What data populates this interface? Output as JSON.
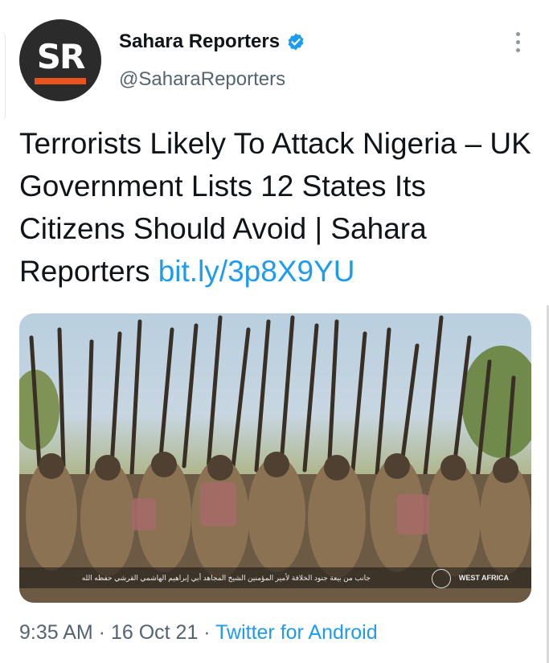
{
  "tweet": {
    "author_name": "Sahara Reporters",
    "handle": "@SaharaReporters",
    "avatar_text": "SR",
    "text": "Terrorists Likely To Attack Nigeria – UK Government Lists 12 States Its Citizens Should Avoid | Sahara Reporters ",
    "link": "bit.ly/3p8X9YU",
    "time": "9:35 AM",
    "separator": " · ",
    "date": "16 Oct 21",
    "source": "Twitter for Android"
  },
  "media": {
    "caption_arabic": "جانب من بيعة جنود الخلافة لأمير المؤمنين الشيخ المجاهد أبي إبراهيم الهاشمي القرشي حفظه الله",
    "region_label": "WEST AFRICA"
  },
  "icons": {
    "verified": "verified-badge-icon",
    "more": "more-options-icon"
  },
  "colors": {
    "link": "#1d9bf0",
    "secondary_text": "#536471",
    "avatar_bg": "#2b2b2b",
    "avatar_bar": "#e8541c"
  }
}
